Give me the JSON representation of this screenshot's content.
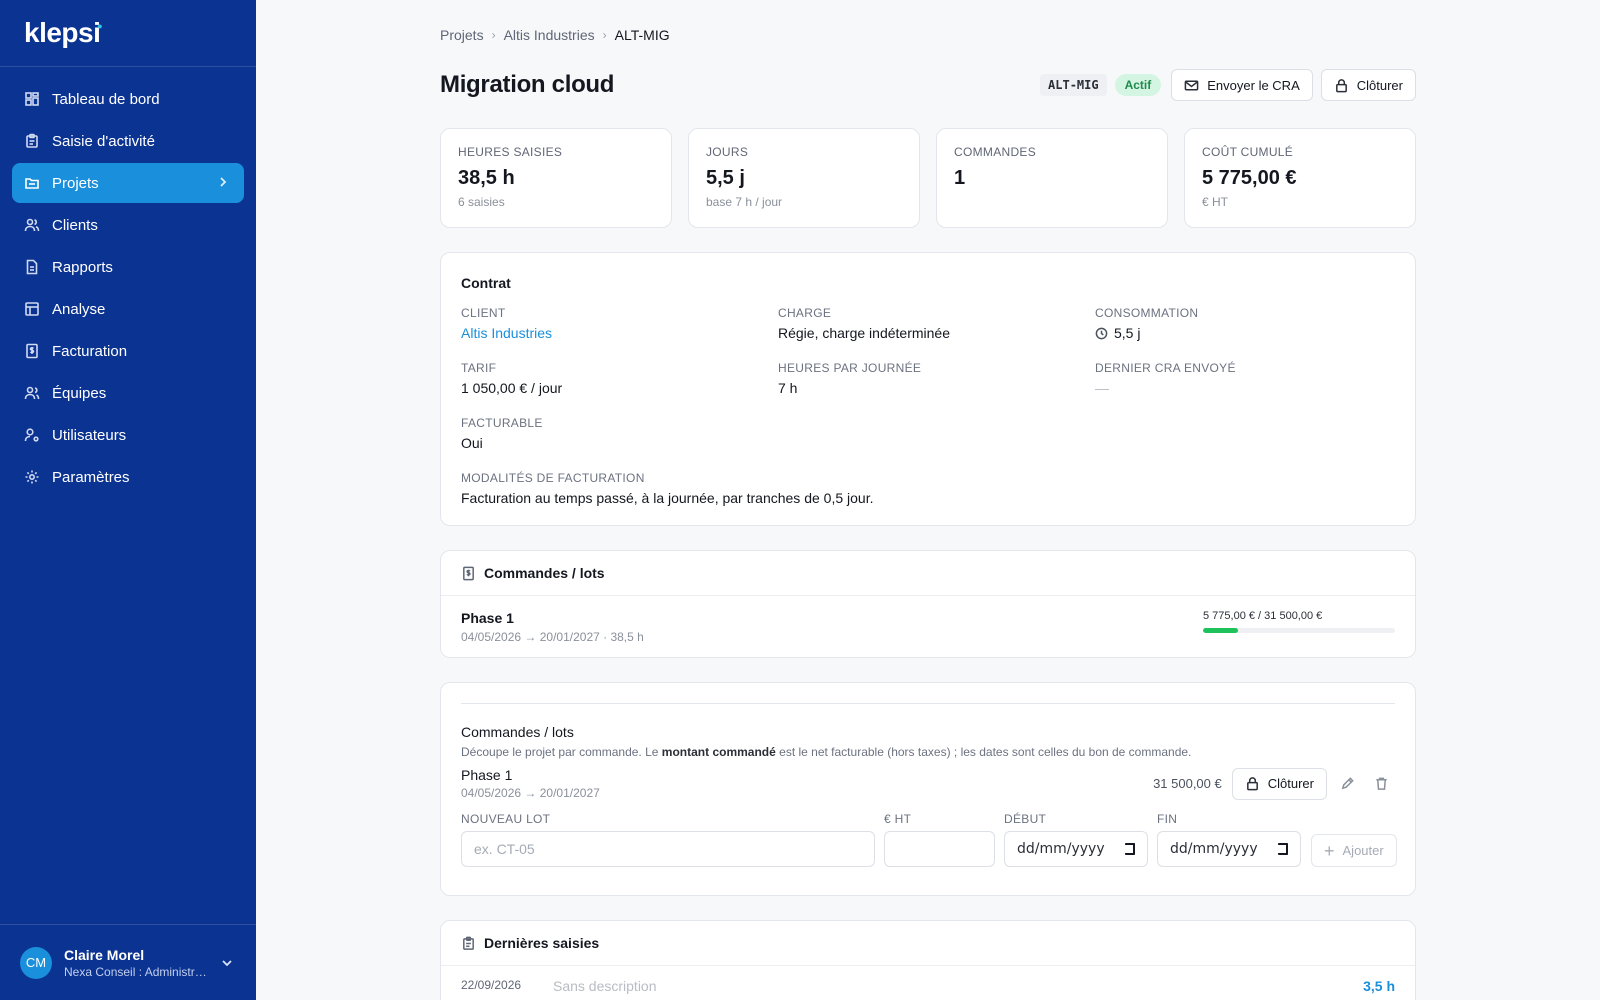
{
  "brand": "klepsi",
  "sidebar": {
    "items": [
      {
        "label": "Tableau de bord",
        "icon": "dashboard-icon"
      },
      {
        "label": "Saisie d'activité",
        "icon": "clipboard-icon"
      },
      {
        "label": "Projets",
        "icon": "folder-icon",
        "active": true
      },
      {
        "label": "Clients",
        "icon": "users-icon"
      },
      {
        "label": "Rapports",
        "icon": "file-text-icon"
      },
      {
        "label": "Analyse",
        "icon": "table-icon"
      },
      {
        "label": "Facturation",
        "icon": "receipt-icon"
      },
      {
        "label": "Équipes",
        "icon": "team-icon"
      },
      {
        "label": "Utilisateurs",
        "icon": "user-cog-icon"
      },
      {
        "label": "Paramètres",
        "icon": "gear-icon"
      }
    ]
  },
  "user": {
    "initials": "CM",
    "name": "Claire Morel",
    "org": "Nexa Conseil : Administr…"
  },
  "breadcrumb": [
    "Projets",
    "Altis Industries",
    "ALT-MIG"
  ],
  "page": {
    "title": "Migration cloud",
    "code": "ALT-MIG",
    "status": "Actif",
    "send_cra_label": "Envoyer le CRA",
    "close_label": "Clôturer"
  },
  "stats": [
    {
      "label": "HEURES SAISIES",
      "value": "38,5 h",
      "sub": "6 saisies"
    },
    {
      "label": "JOURS",
      "value": "5,5 j",
      "sub": "base 7 h / jour"
    },
    {
      "label": "COMMANDES",
      "value": "1",
      "sub": ""
    },
    {
      "label": "COÛT CUMULÉ",
      "value": "5 775,00 €",
      "sub": "€ HT"
    }
  ],
  "contract": {
    "title": "Contrat",
    "client_label": "CLIENT",
    "client": "Altis Industries",
    "charge_label": "CHARGE",
    "charge": "Régie, charge indéterminée",
    "consumption_label": "CONSOMMATION",
    "consumption": "5,5 j",
    "rate_label": "TARIF",
    "rate": "1 050,00 € / jour",
    "hours_label": "HEURES PAR JOURNÉE",
    "hours": "7 h",
    "last_cra_label": "DERNIER CRA ENVOYÉ",
    "last_cra": "—",
    "billable_label": "FACTURABLE",
    "billable": "Oui",
    "terms_label": "MODALITÉS DE FACTURATION",
    "terms": "Facturation au temps passé, à la journée, par tranches de 0,5 jour."
  },
  "orders": {
    "title": "Commandes / lots",
    "items": [
      {
        "name": "Phase 1",
        "meta": "04/05/2026 → 20/01/2027 · 38,5 h",
        "amount": "5 775,00 € / 31 500,00 €",
        "progress": 0.183
      }
    ]
  },
  "lots": {
    "title": "Commandes / lots",
    "desc_before": "Découpe le projet par commande. Le ",
    "desc_bold": "montant commandé",
    "desc_after": " est le net facturable (hors taxes) ; les dates sont celles du bon de commande.",
    "items": [
      {
        "name": "Phase 1",
        "dates": "04/05/2026 → 20/01/2027",
        "amount": "31 500,00 €",
        "close_label": "Clôturer"
      }
    ],
    "new_lot_label": "NOUVEAU LOT",
    "new_lot_placeholder": "ex. CT-05",
    "ht_label": "€ HT",
    "start_label": "DÉBUT",
    "end_label": "FIN",
    "date_placeholder": "dd/mm/yyyy",
    "add_label": "Ajouter"
  },
  "recent": {
    "title": "Dernières saisies",
    "items": [
      {
        "date": "22/09/2026",
        "desc": "Sans description",
        "hours": "3,5 h"
      }
    ]
  }
}
